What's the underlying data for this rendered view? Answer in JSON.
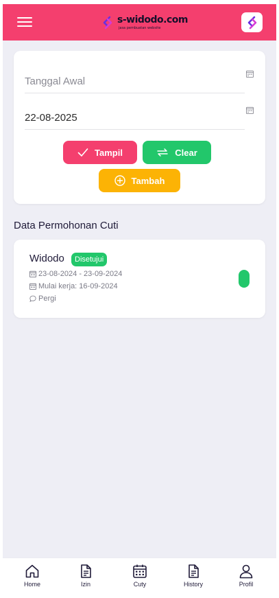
{
  "header": {
    "brand_name": "s-widodo.com",
    "brand_tagline": "jasa pembuatan website",
    "menu_icon": "hamburger-icon",
    "avatar_icon": "brand-logo-icon"
  },
  "filter": {
    "start_date_placeholder": "Tanggal Awal",
    "end_date_value": "22-08-2025",
    "buttons": {
      "tampil": "Tampil",
      "clear": "Clear",
      "tambah": "Tambah"
    }
  },
  "section_title": "Data Permohonan Cuti",
  "leave_items": [
    {
      "name": "Widodo",
      "status": "Disetujui",
      "period": "23-08-2024 - 23-09-2024",
      "return_date": "Mulai kerja: 16-09-2024",
      "reason": "Pergi"
    }
  ],
  "bottom_nav": [
    {
      "label": "Home",
      "icon": "home-icon"
    },
    {
      "label": "Izin",
      "icon": "document-icon"
    },
    {
      "label": "Cuty",
      "icon": "calendar-icon"
    },
    {
      "label": "History",
      "icon": "document-icon"
    },
    {
      "label": "Profil",
      "icon": "user-icon"
    }
  ],
  "colors": {
    "primary": "#f43f6e",
    "success": "#22c76b",
    "warning": "#fcb305",
    "background": "#eeeef5",
    "text_dark": "#1f1a38"
  }
}
